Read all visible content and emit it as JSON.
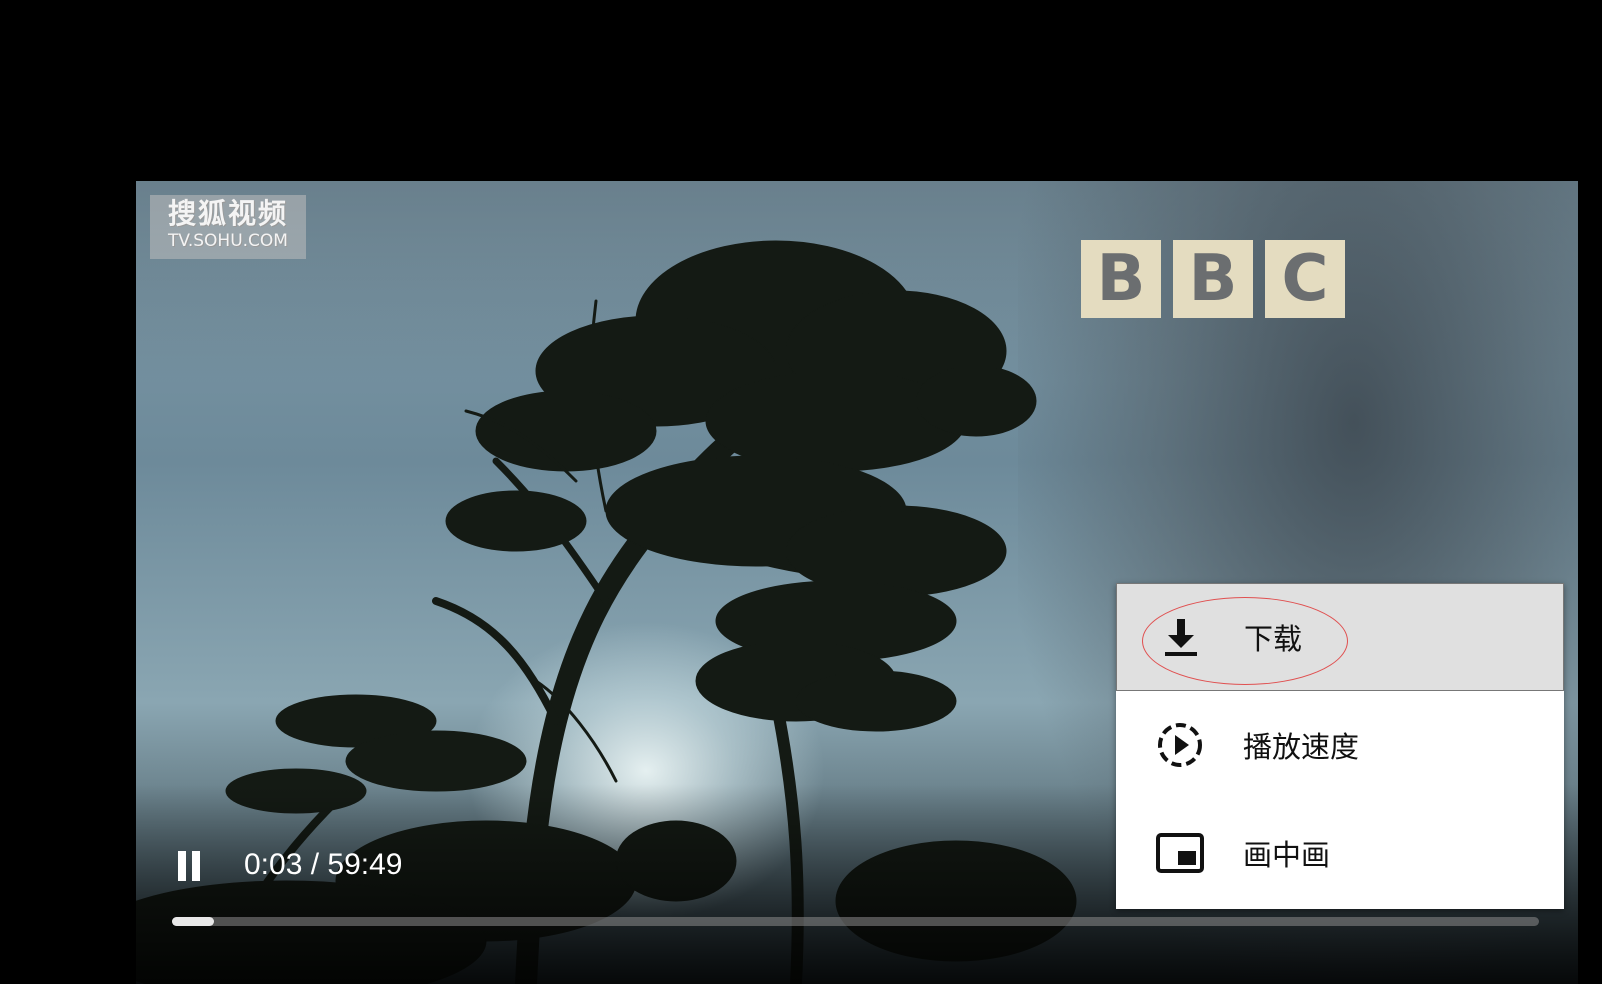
{
  "video": {
    "watermark_cn": "搜狐视频",
    "watermark_en": "TV.SOHU.COM",
    "bbc_letters": [
      "B",
      "B",
      "C"
    ]
  },
  "controls": {
    "play_state_icon": "pause-icon",
    "time_display": "0:03 / 59:49",
    "progress_fraction": 0.031
  },
  "menu": {
    "items": [
      {
        "label": "下载",
        "icon": "download-icon"
      },
      {
        "label": "播放速度",
        "icon": "playback-speed-icon"
      },
      {
        "label": "画中画",
        "icon": "picture-in-picture-icon"
      }
    ]
  },
  "colors": {
    "annotation": "#e05050",
    "menu_highlight": "#e0e0e0",
    "bbc_block": "#e4dcc0"
  }
}
